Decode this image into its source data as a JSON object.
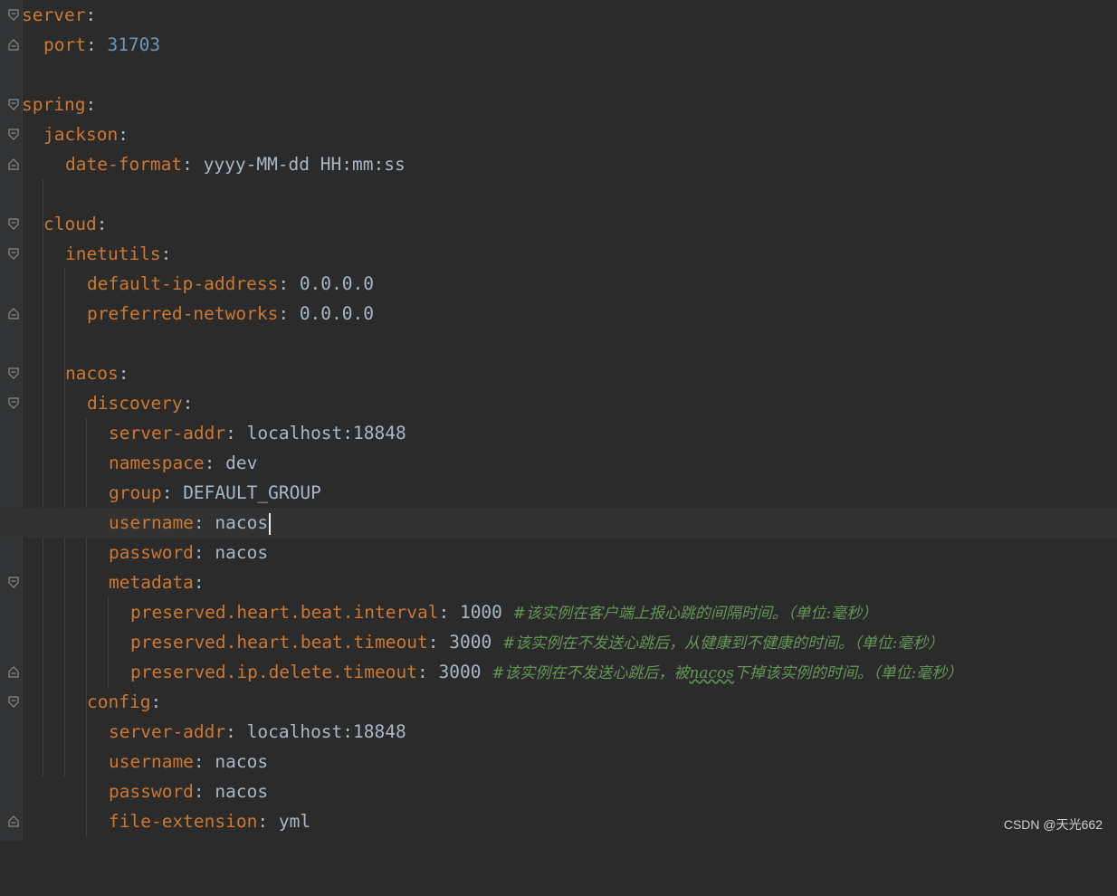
{
  "editor": {
    "lines": [
      {
        "key": "server",
        "colon": ":"
      },
      {
        "key": "port",
        "colon": ": ",
        "value": "31703"
      },
      {
        "key": "spring",
        "colon": ":"
      },
      {
        "key": "jackson",
        "colon": ":"
      },
      {
        "key": "date-format",
        "colon": ": ",
        "value": "yyyy-MM-dd HH:mm:ss"
      },
      {
        "key": "cloud",
        "colon": ":"
      },
      {
        "key": "inetutils",
        "colon": ":"
      },
      {
        "key": "default-ip-address",
        "colon": ": ",
        "value": "0.0.0.0"
      },
      {
        "key": "preferred-networks",
        "colon": ": ",
        "value": "0.0.0.0"
      },
      {
        "key": "nacos",
        "colon": ":"
      },
      {
        "key": "discovery",
        "colon": ":"
      },
      {
        "key": "server-addr",
        "colon": ": ",
        "value": "localhost:18848"
      },
      {
        "key": "namespace",
        "colon": ": ",
        "value": "dev"
      },
      {
        "key": "group",
        "colon": ": ",
        "value": "DEFAULT_GROUP"
      },
      {
        "key": "username",
        "colon": ": ",
        "value": "nacos"
      },
      {
        "key": "password",
        "colon": ": ",
        "value": "nacos"
      },
      {
        "key": "metadata",
        "colon": ":"
      },
      {
        "key": "preserved.heart.beat.interval",
        "colon": ": ",
        "value": "1000",
        "comment": "#该实例在客户端上报心跳的间隔时间。（单位:毫秒）"
      },
      {
        "key": "preserved.heart.beat.timeout",
        "colon": ": ",
        "value": "3000",
        "comment": "#该实例在不发送心跳后，从健康到不健康的时间。（单位:毫秒）"
      },
      {
        "key": "preserved.ip.delete.timeout",
        "colon": ": ",
        "value": "3000",
        "comment_pre": "#该实例在不发送心跳后，被",
        "comment_word": "nacos",
        "comment_post": "下掉该实例的时间。（单位:毫秒）"
      },
      {
        "key": "config",
        "colon": ":"
      },
      {
        "key": "server-addr",
        "colon": ": ",
        "value": "localhost:18848"
      },
      {
        "key": "username",
        "colon": ": ",
        "value": "nacos"
      },
      {
        "key": "password",
        "colon": ": ",
        "value": "nacos"
      },
      {
        "key": "file-extension",
        "colon": ": ",
        "value": "yml"
      }
    ]
  },
  "watermark": "CSDN @天光662",
  "colors": {
    "key": "#cc7832",
    "value": "#a9b7c6",
    "number": "#6897bb",
    "comment": "#629755",
    "background": "#2b2b2b"
  },
  "icons": [
    "fold-open-icon",
    "fold-close-icon"
  ]
}
